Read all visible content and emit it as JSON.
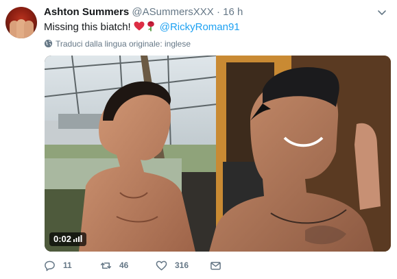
{
  "tweet": {
    "author_name": "Ashton Summers",
    "author_handle": "@ASummersXXX",
    "separator": "·",
    "time": "16 h",
    "text_prefix": "Missing this biatch!",
    "emojis": [
      "red-heart-icon",
      "rose-icon"
    ],
    "mention": "@RickyRoman91",
    "translate_label": "Traduci dalla lingua originale: inglese",
    "video_duration": "0:02",
    "reply_count": "11",
    "retweet_count": "46",
    "like_count": "316"
  },
  "colors": {
    "link": "#1da1f2",
    "secondary_text": "#657786",
    "heart": "#e0245e"
  }
}
